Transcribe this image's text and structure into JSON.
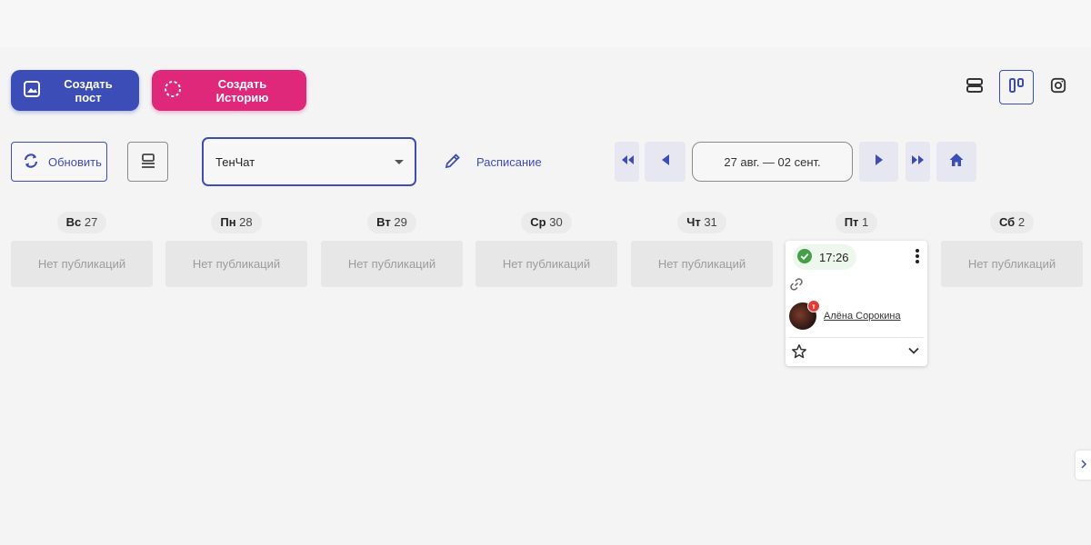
{
  "toolbar": {
    "create_post_label": "Создать пост",
    "create_story_label": "Создать Историю",
    "refresh_label": "Обновить",
    "schedule_label": "Расписание"
  },
  "network_select": {
    "value": "ТенЧат"
  },
  "date_range": "27 авг. — 02 сент.",
  "days": [
    {
      "abbr": "Вс",
      "num": "27",
      "empty_text": "Нет публикаций"
    },
    {
      "abbr": "Пн",
      "num": "28",
      "empty_text": "Нет публикаций"
    },
    {
      "abbr": "Вт",
      "num": "29",
      "empty_text": "Нет публикаций"
    },
    {
      "abbr": "Ср",
      "num": "30",
      "empty_text": "Нет публикаций"
    },
    {
      "abbr": "Чт",
      "num": "31",
      "empty_text": "Нет публикаций"
    },
    {
      "abbr": "Пт",
      "num": "1"
    },
    {
      "abbr": "Сб",
      "num": "2",
      "empty_text": "Нет публикаций"
    }
  ],
  "post": {
    "time": "17:26",
    "status_icon": "check-circle-icon",
    "author": "Алёна Сорокина",
    "network_badge": "т"
  },
  "colors": {
    "accent": "#3d4db7",
    "story": "#e0287b",
    "success": "#43a047",
    "badge": "#e53935"
  }
}
